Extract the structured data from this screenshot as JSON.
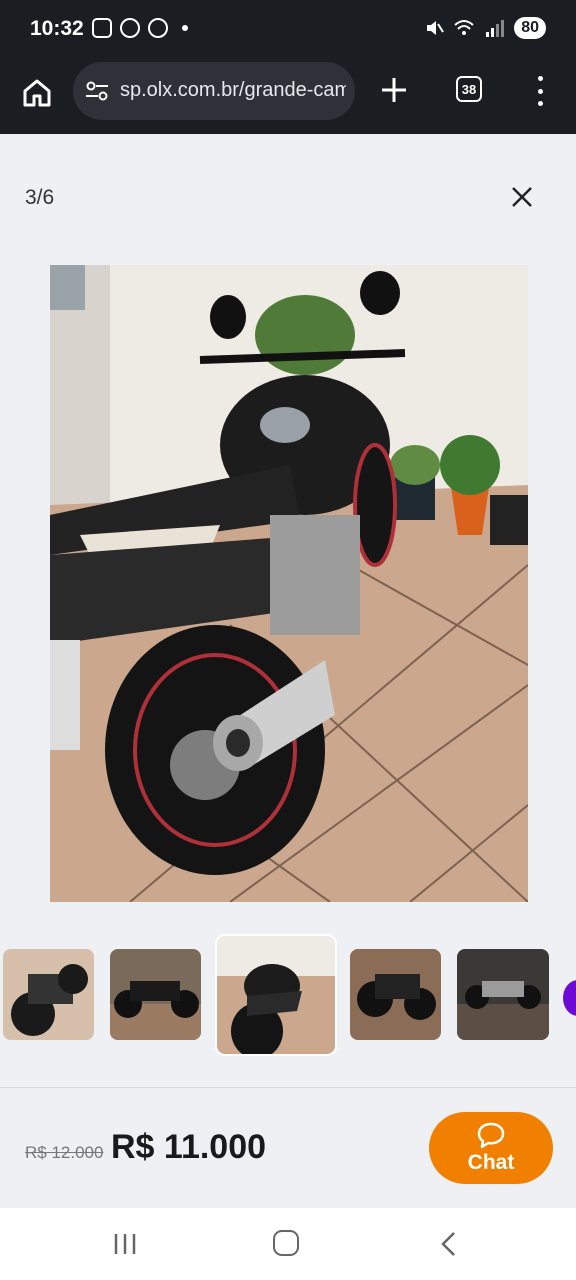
{
  "status_bar": {
    "time": "10:32",
    "battery": "80",
    "icons": [
      "screenshot-icon",
      "app-notification-icon",
      "whatsapp-icon",
      "notification-dot",
      "mute-icon",
      "wifi-icon",
      "signal-icon"
    ]
  },
  "browser": {
    "url": "sp.olx.com.br/grande-campinas",
    "tab_count": "38",
    "icons": [
      "home-icon",
      "tune-icon",
      "plus-icon",
      "tabs-icon",
      "more-vert-icon"
    ]
  },
  "gallery": {
    "counter": "3/6",
    "close_icon": "close-icon",
    "current_index": 3,
    "total": 6
  },
  "listing": {
    "old_price": "R$ 12.000",
    "price": "R$ 11.000",
    "chat_label": "Chat",
    "chat_icon": "chat-bubble-icon"
  },
  "colors": {
    "accent_orange": "#f28000",
    "olx_purple": "#6e0ad6",
    "status_bg": "#1a1d22",
    "page_bg": "#eef0f4"
  },
  "android_nav": {
    "icons": [
      "recents-icon",
      "home-circle-icon",
      "back-icon"
    ]
  }
}
